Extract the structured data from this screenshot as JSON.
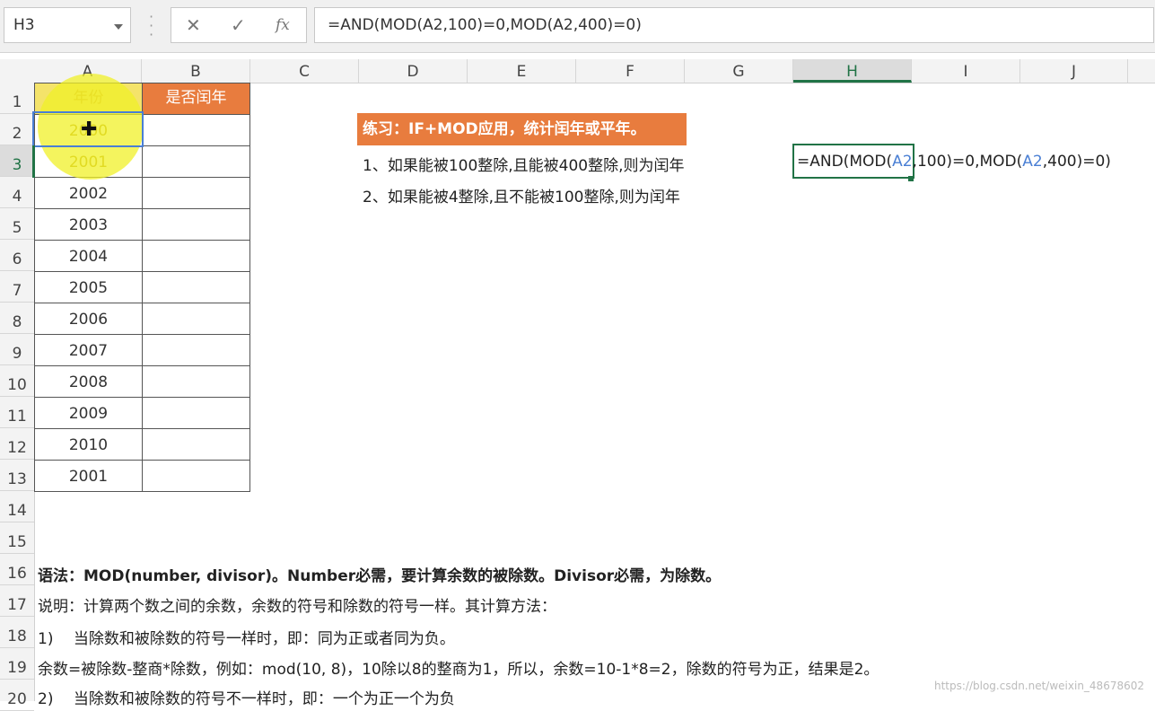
{
  "formula_bar": {
    "name_box": "H3",
    "cancel_icon": "✕",
    "confirm_icon": "✓",
    "fx_label": "fx",
    "formula": "=AND(MOD(A2,100)=0,MOD(A2,400)=0)"
  },
  "columns": [
    "A",
    "B",
    "C",
    "D",
    "E",
    "F",
    "G",
    "H",
    "I",
    "J"
  ],
  "selected_column": "H",
  "rows": [
    "1",
    "2",
    "3",
    "4",
    "5",
    "6",
    "7",
    "8",
    "9",
    "10",
    "11",
    "12",
    "13",
    "14",
    "15",
    "16",
    "17",
    "18",
    "19",
    "20"
  ],
  "selected_row": "3",
  "table": {
    "header_a": "年份",
    "header_b": "是否闰年",
    "years": [
      "2000",
      "2001",
      "2002",
      "2003",
      "2004",
      "2005",
      "2006",
      "2007",
      "2008",
      "2009",
      "2010",
      "2001"
    ]
  },
  "exercise": {
    "title": "练习：IF+MOD应用，统计闰年或平年。",
    "rule1": "1、如果能被100整除,且能被400整除,则为闰年",
    "rule2": "2、如果能被4整除,且不能被100整除,则为闰年"
  },
  "active_cell_formula": {
    "p1": "=AND(MOD(",
    "ref1": "A2",
    "p2": ",100)=0,MOD(",
    "ref2": "A2",
    "p3": ",400)=0)"
  },
  "notes": {
    "syntax": "语法：MOD(number, divisor)。Number必需，要计算余数的被除数。Divisor必需，为除数。",
    "explain": "说明：计算两个数之间的余数，余数的符号和除数的符号一样。其计算方法：",
    "case1": "1)　 当除数和被除数的符号一样时，即：同为正或者同为负。",
    "example": "余数=被除数-整商*除数，例如：mod(10, 8)，10除以8的整商为1，所以，余数=10-1*8=2，除数的符号为正，结果是2。",
    "case2": "2)　 当除数和被除数的符号不一样时，即：一个为正一个为负"
  },
  "watermark": "https://blog.csdn.net/weixin_48678602",
  "colors": {
    "accent_orange": "#e87c3e",
    "excel_green": "#217346",
    "ref_blue": "#4a7fd4"
  }
}
